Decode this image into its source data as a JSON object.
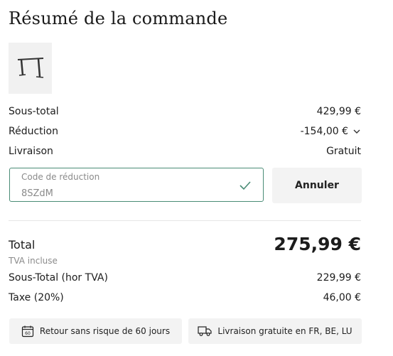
{
  "summary": {
    "title": "Résumé de la commande",
    "product_image_icon": "desk-frame-icon"
  },
  "lines": {
    "subtotal_label": "Sous-total",
    "subtotal_value": "429,99 €",
    "discount_label": "Réduction",
    "discount_value": "-154,00 €",
    "discount_icon": "chevron-down-icon",
    "shipping_label": "Livraison",
    "shipping_value": "Gratuit"
  },
  "coupon": {
    "label": "Code de réduction",
    "value": "8SZdM",
    "check_icon": "check-icon",
    "cancel_label": "Annuler",
    "accent_color": "#4a8c76"
  },
  "totals": {
    "total_label": "Total",
    "total_value": "275,99 €",
    "vat_note": "TVA incluse",
    "pre_tax_label": "Sous-Total (hor TVA)",
    "pre_tax_value": "229,99 €",
    "tax_label": "Taxe (20%)",
    "tax_value": "46,00 €"
  },
  "perks": {
    "returns_icon": "calendar-60-icon",
    "returns_label": "Retour sans risque de 60 jours",
    "shipping_icon": "delivery-truck-icon",
    "shipping_label": "Livraison gratuite en FR, BE, LU"
  }
}
